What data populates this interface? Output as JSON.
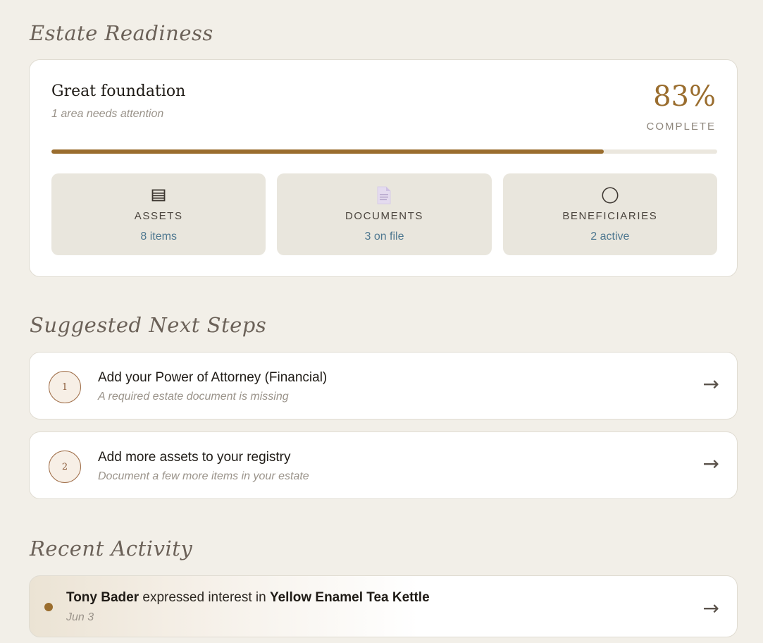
{
  "readiness": {
    "section_title": "Estate Readiness",
    "headline": "Great foundation",
    "subtitle": "1 area needs attention",
    "percent_text": "83%",
    "percent_value": 83,
    "percent_label": "COMPLETE",
    "tiles": [
      {
        "icon": "list-icon",
        "label": "ASSETS",
        "value": "8 items"
      },
      {
        "icon": "document-icon",
        "label": "DOCUMENTS",
        "value": "3 on file"
      },
      {
        "icon": "circle-icon",
        "label": "BENEFICIARIES",
        "value": "2 active"
      }
    ]
  },
  "next_steps": {
    "section_title": "Suggested Next Steps",
    "items": [
      {
        "number": "1",
        "title": "Add your Power of Attorney (Financial)",
        "subtitle": "A required estate document is missing",
        "arrow": "→"
      },
      {
        "number": "2",
        "title": "Add more assets to your registry",
        "subtitle": "Document a few more items in your estate",
        "arrow": "→"
      }
    ]
  },
  "activity": {
    "section_title": "Recent Activity",
    "items": [
      {
        "actor": "Tony Bader",
        "action": " expressed interest in ",
        "object": "Yellow Enamel Tea Kettle",
        "date": "Jun 3",
        "arrow": "→"
      }
    ]
  },
  "colors": {
    "accent": "#9a6d2e",
    "background": "#f2efe8",
    "tile": "#e9e6dd",
    "value_blue": "#4f7890"
  }
}
